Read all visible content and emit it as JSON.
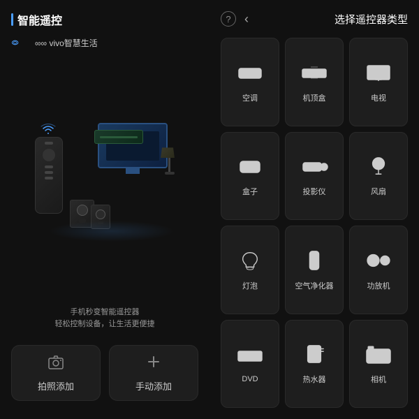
{
  "leftPanel": {
    "title": "智能遥控",
    "vivoLogo": "∞∞ vivo智慧生活",
    "tagline": {
      "line1": "手机秒变智能遥控器",
      "line2": "轻松控制设备，让生活更便捷"
    },
    "buttons": {
      "photo": "拍照添加",
      "manual": "手动添加"
    }
  },
  "rightPanel": {
    "title": "选择遥控器类型",
    "helpIcon": "?",
    "backIcon": "‹",
    "devices": [
      {
        "id": "ac",
        "label": "空调"
      },
      {
        "id": "stb",
        "label": "机顶盒"
      },
      {
        "id": "tv",
        "label": "电视"
      },
      {
        "id": "box",
        "label": "盒子"
      },
      {
        "id": "proj",
        "label": "投影仪"
      },
      {
        "id": "fan",
        "label": "风扇"
      },
      {
        "id": "bulb",
        "label": "灯泡"
      },
      {
        "id": "air",
        "label": "空气净化器"
      },
      {
        "id": "amp",
        "label": "功放机"
      },
      {
        "id": "dvd",
        "label": "DVD"
      },
      {
        "id": "water",
        "label": "热水器"
      },
      {
        "id": "camera",
        "label": "相机"
      }
    ]
  }
}
